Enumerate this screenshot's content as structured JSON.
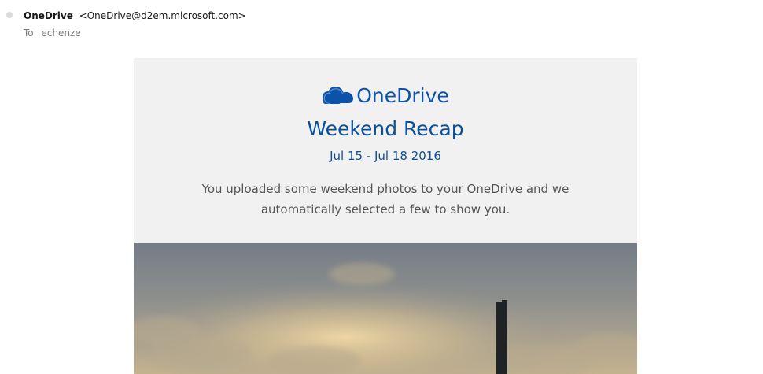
{
  "header": {
    "sender_name": "OneDrive",
    "sender_email": "<OneDrive@d2em.microsoft.com>",
    "to_label": "To",
    "recipient": "echenze"
  },
  "newsletter": {
    "brand_name": "OneDrive",
    "title": "Weekend Recap",
    "date_range": "Jul 15 - Jul 18 2016",
    "message": "You uploaded some weekend photos to your OneDrive and we automatically selected a few to show you."
  },
  "colors": {
    "brand_blue": "#0b52a8",
    "card_background": "#f1f1f1",
    "body_text": "#555555"
  },
  "icons": {
    "brand_logo": "cloud-icon",
    "status_indicator": "unread-dot-icon"
  }
}
